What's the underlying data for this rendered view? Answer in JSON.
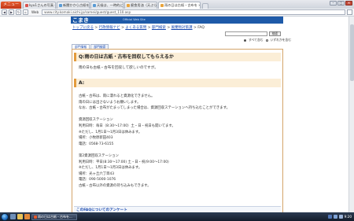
{
  "browser": {
    "menu_label": "メニュー",
    "tabs": [
      {
        "label": "kyu1さんの写真 - 動画",
        "active": false,
        "color": "#d9534f"
      },
      {
        "label": "新聞かから古紙を回収",
        "active": false,
        "color": "#5a9bd5"
      },
      {
        "label": "天候は、一時的にも",
        "active": false,
        "color": "#5a9bd5"
      },
      {
        "label": "廃食用油（天ぷら油）",
        "active": false,
        "color": "#e8a43d"
      },
      {
        "label": "雨の日は古紙・古布を",
        "active": true,
        "color": "#e8a43d"
      }
    ],
    "web_label": "Web",
    "url": "www.city.komaki.aichi.jp/samei/guest/guest_110.asp"
  },
  "site": {
    "logo": "こまき",
    "logo_sub": "Official Web Site"
  },
  "breadcrumb": {
    "items": [
      "トップに戻る",
      "行政情報ナビ",
      "よくある質問",
      "部門検索",
      "廃棄物対策課"
    ],
    "current": "FAQ",
    "separator": " > "
  },
  "search": {
    "button": "検索",
    "option_site": "すべて含む",
    "option_any": "いずれかを含む"
  },
  "subtabs": [
    "部門情報",
    "部門検索"
  ],
  "faq": {
    "question_title": "Q:雨の日は古紙・古布を回収してもらえるか",
    "question_body": "雨の日も古紙・古布を回収して欲しいのですが。",
    "answer_title": "A:",
    "answer_body": "古紙・古布は、雨に濡れると資源化できません。\n雨の日には出さないようお願いします。\nなお、古紙・古布がたまってしまった場合は、資源回収ステーションへ持ち込むことができます。\n\n資源回収ステーション\n利用日時：毎日（8:30〜17:00）土・日・祝日も開いてます。\n※ただし、1月1日〜1月3日は休みます。\n場所：小牧原新田403\n電話：0568-73-6155\n\n第2資源回収ステーション\n利用日時：平日(8:30〜17:00) 土・日・祝(9:00〜17:00)\n※ただし、1月1日〜1月3日は休みます。\n場所：光ヶ丘六丁目43\n電話：090-5000-1076\n古紙・古布以外の資源の持ち込みもできます。",
    "enquete_link": "このFAQについてのアンケート"
  },
  "taskbar": {
    "task_label": "雨の日は古紙・古布を...",
    "clock": "9:20"
  }
}
